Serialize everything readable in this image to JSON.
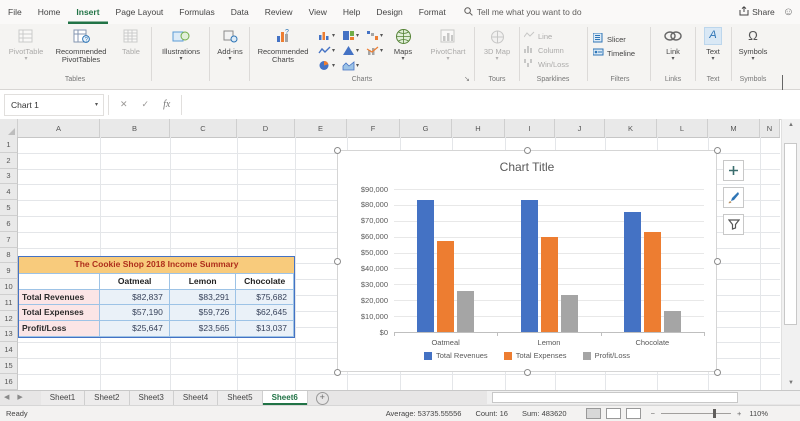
{
  "app": {
    "share_label": "Share",
    "search_placeholder": "Tell me what you want to do"
  },
  "tabs": {
    "items": [
      "File",
      "Home",
      "Insert",
      "Page Layout",
      "Formulas",
      "Data",
      "Review",
      "View",
      "Help",
      "Design",
      "Format"
    ],
    "active": "Insert"
  },
  "ribbon": {
    "tables_group": "Tables",
    "pivottable": "PivotTable",
    "recommended_pivottables": "Recommended PivotTables",
    "table": "Table",
    "illustrations": "Illustrations",
    "addins": "Add-ins",
    "charts_group": "Charts",
    "recommended_charts": "Recommended Charts",
    "maps": "Maps",
    "pivotchart": "PivotChart",
    "tours_group": "Tours",
    "map3d": "3D Map",
    "sparklines_group": "Sparklines",
    "spark_line": "Line",
    "spark_column": "Column",
    "spark_winloss": "Win/Loss",
    "filters_group": "Filters",
    "slicer": "Slicer",
    "timeline": "Timeline",
    "links_group": "Links",
    "link": "Link",
    "text_group": "Text",
    "text": "Text",
    "symbols_group": "Symbols",
    "symbols": "Symbols"
  },
  "formula_bar": {
    "name_box": "Chart 1",
    "fx": "fx"
  },
  "sheet": {
    "columns": [
      "A",
      "B",
      "C",
      "D",
      "E",
      "F",
      "G",
      "H",
      "I",
      "J",
      "K",
      "L",
      "M",
      "N"
    ],
    "row_count": 17,
    "table": {
      "title": "The Cookie Shop 2018 Income Summary",
      "col_headers": [
        "Oatmeal",
        "Lemon",
        "Chocolate"
      ],
      "rows": [
        {
          "label": "Total Revenues",
          "values": [
            "$82,837",
            "$83,291",
            "$75,682"
          ]
        },
        {
          "label": "Total Expenses",
          "values": [
            "$57,190",
            "$59,726",
            "$62,645"
          ]
        },
        {
          "label": "Profit/Loss",
          "values": [
            "$25,647",
            "$23,565",
            "$13,037"
          ]
        }
      ]
    }
  },
  "chart_data": {
    "type": "bar",
    "title": "Chart Title",
    "categories": [
      "Oatmeal",
      "Lemon",
      "Chocolate"
    ],
    "series": [
      {
        "name": "Total Revenues",
        "color": "#4472C4",
        "values": [
          82837,
          83291,
          75682
        ]
      },
      {
        "name": "Total Expenses",
        "color": "#ED7D31",
        "values": [
          57190,
          59726,
          62645
        ]
      },
      {
        "name": "Profit/Loss",
        "color": "#A5A5A5",
        "values": [
          25647,
          23565,
          13037
        ]
      }
    ],
    "ylim": [
      0,
      90000
    ],
    "ytick_step": 10000,
    "ytick_labels": [
      "$0",
      "$10,000",
      "$20,000",
      "$30,000",
      "$40,000",
      "$50,000",
      "$60,000",
      "$70,000",
      "$80,000",
      "$90,000"
    ],
    "grid": true,
    "legend_position": "bottom"
  },
  "sheet_tabs": {
    "items": [
      "Sheet1",
      "Sheet2",
      "Sheet3",
      "Sheet4",
      "Sheet5",
      "Sheet6"
    ],
    "active": "Sheet6"
  },
  "status_bar": {
    "mode": "Ready",
    "average": "Average: 53735.55556",
    "count": "Count: 16",
    "sum": "Sum: 483620",
    "zoom_level": "110%"
  },
  "colors": {
    "excel_green": "#217346",
    "title_fill": "#F8CB7C",
    "title_text": "#AE2E1C",
    "label_fill": "#FBE5E6",
    "value_fill": "#EAF1F8",
    "range_border": "#4472C4"
  }
}
